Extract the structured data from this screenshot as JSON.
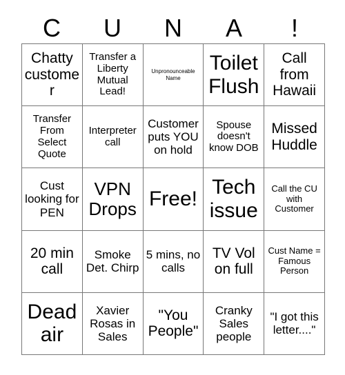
{
  "card": {
    "title_letters": [
      "C",
      "U",
      "N",
      "A",
      "!"
    ],
    "rows": [
      [
        {
          "text": "Chatty customer",
          "size": "fs-l"
        },
        {
          "text": "Transfer a Liberty Mutual Lead!",
          "size": "fs-s"
        },
        {
          "text": "Unpronounceable Name",
          "size": "fs-xxs"
        },
        {
          "text": "Toilet Flush",
          "size": "fs-xxl"
        },
        {
          "text": "Call from Hawaii",
          "size": "fs-l"
        }
      ],
      [
        {
          "text": "Transfer From Select Quote",
          "size": "fs-s"
        },
        {
          "text": "Interpreter call",
          "size": "fs-s"
        },
        {
          "text": "Customer puts YOU on hold",
          "size": "fs-m"
        },
        {
          "text": "Spouse doesn't know DOB",
          "size": "fs-s"
        },
        {
          "text": "Missed Huddle",
          "size": "fs-l"
        }
      ],
      [
        {
          "text": "Cust looking for PEN",
          "size": "fs-m"
        },
        {
          "text": "VPN Drops",
          "size": "fs-xl"
        },
        {
          "text": "Free!",
          "size": "fs-xxl"
        },
        {
          "text": "Tech issue",
          "size": "fs-xxl"
        },
        {
          "text": "Call the CU with Customer",
          "size": "fs-xs"
        }
      ],
      [
        {
          "text": "20 min call",
          "size": "fs-l"
        },
        {
          "text": "Smoke Det. Chirp",
          "size": "fs-m"
        },
        {
          "text": "5 mins, no calls",
          "size": "fs-m"
        },
        {
          "text": "TV Vol on full",
          "size": "fs-l"
        },
        {
          "text": "Cust Name = Famous Person",
          "size": "fs-xs"
        }
      ],
      [
        {
          "text": "Dead air",
          "size": "fs-xxl"
        },
        {
          "text": "Xavier Rosas in Sales",
          "size": "fs-m"
        },
        {
          "text": "\"You People\"",
          "size": "fs-l"
        },
        {
          "text": "Cranky Sales people",
          "size": "fs-m"
        },
        {
          "text": "\"I got this letter....\"",
          "size": "fs-m"
        }
      ]
    ]
  },
  "colors": {
    "background": "#ffffff",
    "text": "#000000",
    "grid_line": "#777777"
  }
}
